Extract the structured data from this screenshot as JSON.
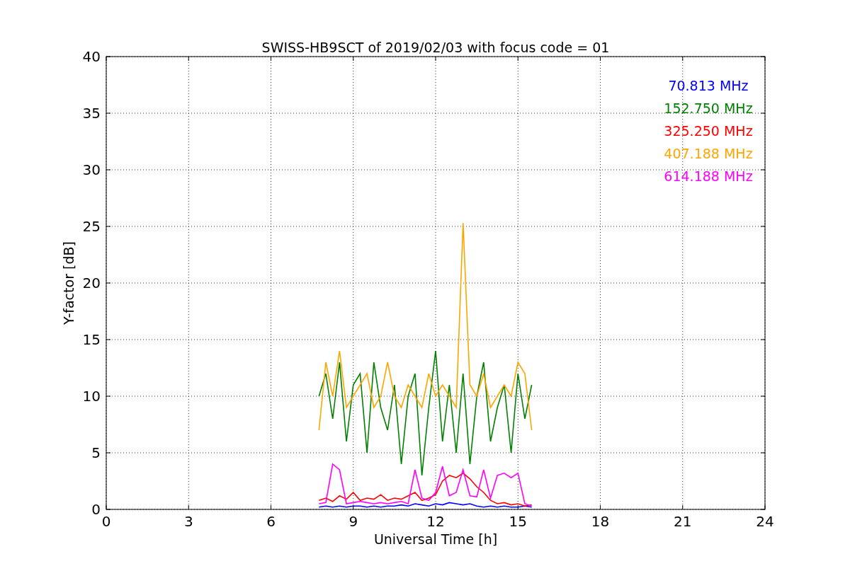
{
  "chart_data": {
    "type": "line",
    "grid": true,
    "title": "SWISS-HB9SCT of 2019/02/03 with focus code = 01",
    "xlabel": "Universal Time [h]",
    "ylabel": "Y-factor [dB]",
    "xlim": [
      0,
      24
    ],
    "ylim": [
      0,
      40
    ],
    "xticks": [
      0,
      3,
      6,
      9,
      12,
      15,
      18,
      21,
      24
    ],
    "yticks": [
      0,
      5,
      10,
      15,
      20,
      25,
      30,
      35,
      40
    ],
    "x": [
      7.75,
      8,
      8.25,
      8.5,
      8.75,
      9,
      9.25,
      9.5,
      9.75,
      10,
      10.25,
      10.5,
      10.75,
      11,
      11.25,
      11.5,
      11.75,
      12,
      12.25,
      12.5,
      12.75,
      13,
      13.25,
      13.5,
      13.75,
      14,
      14.25,
      14.5,
      14.75,
      15,
      15.25,
      15.5
    ],
    "series": [
      {
        "name": "70.813 MHz",
        "color": "#0000ff",
        "values": [
          0.2,
          0.3,
          0.2,
          0.3,
          0.2,
          0.3,
          0.3,
          0.2,
          0.3,
          0.2,
          0.3,
          0.3,
          0.4,
          0.3,
          0.5,
          0.4,
          0.3,
          0.5,
          0.4,
          0.6,
          0.5,
          0.4,
          0.5,
          0.3,
          0.2,
          0.3,
          0.2,
          0.3,
          0.2,
          0.2,
          0.3,
          0.2
        ]
      },
      {
        "name": "152.750 MHz",
        "color": "#008000",
        "values": [
          10,
          12,
          8,
          13,
          6,
          11,
          12,
          5,
          13,
          9,
          7,
          11,
          4,
          10,
          12,
          3,
          9,
          14,
          6,
          11,
          5,
          12,
          4,
          10,
          13,
          6,
          9,
          11,
          5,
          12,
          8,
          11
        ]
      },
      {
        "name": "325.250 MHz",
        "color": "#ff0000",
        "values": [
          0.8,
          1,
          0.7,
          1.2,
          0.9,
          1.5,
          0.8,
          1,
          0.9,
          1.3,
          0.8,
          1,
          0.9,
          1.2,
          1.5,
          0.8,
          1,
          1.3,
          2.5,
          3,
          2.8,
          3.2,
          2.7,
          2,
          1.5,
          0.8,
          0.5,
          0.6,
          0.4,
          0.5,
          0.3,
          0.4
        ]
      },
      {
        "name": "407.188 MHz",
        "color": "#ffa500",
        "values": [
          7,
          13,
          10,
          14,
          9,
          10,
          11,
          12,
          9,
          10,
          13,
          10,
          9,
          11,
          10,
          9,
          12,
          10,
          11,
          10,
          9,
          25.3,
          11,
          10,
          12,
          9,
          10,
          11,
          10,
          13,
          12,
          7
        ]
      },
      {
        "name": "614.188 MHz",
        "color": "#ff00ff",
        "values": [
          0.5,
          0.6,
          4,
          3.5,
          0.5,
          0.6,
          0.7,
          0.6,
          0.5,
          0.6,
          0.5,
          0.6,
          0.7,
          0.5,
          3.5,
          1,
          0.8,
          1.5,
          3.8,
          1.2,
          1.5,
          3.5,
          1.2,
          1.1,
          3.5,
          1,
          3,
          3.2,
          2.8,
          3.2,
          0.5,
          0.3
        ]
      }
    ]
  }
}
